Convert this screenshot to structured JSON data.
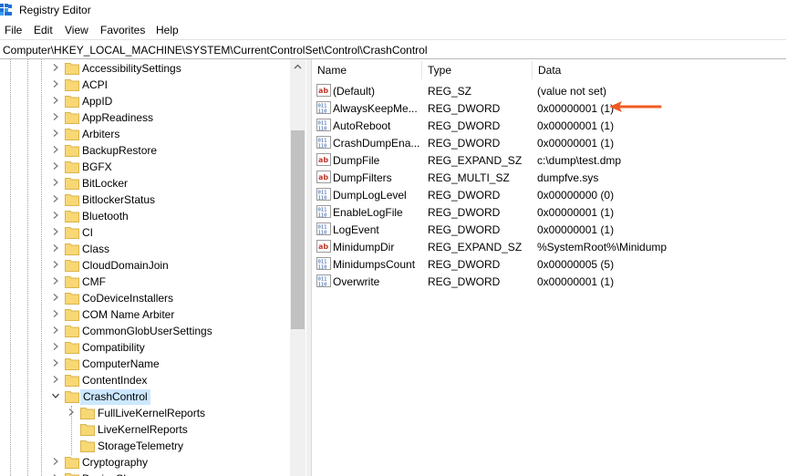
{
  "window": {
    "title": "Registry Editor",
    "icon": "registry-editor-icon"
  },
  "menu": [
    "File",
    "Edit",
    "View",
    "Favorites",
    "Help"
  ],
  "address": "Computer\\HKEY_LOCAL_MACHINE\\SYSTEM\\CurrentControlSet\\Control\\CrashControl",
  "tree": {
    "items": [
      {
        "label": "AccessibilitySettings"
      },
      {
        "label": "ACPI"
      },
      {
        "label": "AppID"
      },
      {
        "label": "AppReadiness"
      },
      {
        "label": "Arbiters"
      },
      {
        "label": "BackupRestore"
      },
      {
        "label": "BGFX"
      },
      {
        "label": "BitLocker"
      },
      {
        "label": "BitlockerStatus"
      },
      {
        "label": "Bluetooth"
      },
      {
        "label": "CI"
      },
      {
        "label": "Class"
      },
      {
        "label": "CloudDomainJoin"
      },
      {
        "label": "CMF"
      },
      {
        "label": "CoDeviceInstallers"
      },
      {
        "label": "COM Name Arbiter"
      },
      {
        "label": "CommonGlobUserSettings"
      },
      {
        "label": "Compatibility"
      },
      {
        "label": "ComputerName"
      },
      {
        "label": "ContentIndex"
      },
      {
        "label": "CrashControl"
      },
      {
        "label": "FullLiveKernelReports"
      },
      {
        "label": "LiveKernelReports"
      },
      {
        "label": "StorageTelemetry"
      },
      {
        "label": "Cryptography"
      },
      {
        "label": "DeviceClasses"
      }
    ],
    "selected": "CrashControl"
  },
  "list": {
    "columns": [
      "Name",
      "Type",
      "Data"
    ],
    "rows": [
      {
        "name": "(Default)",
        "type": "REG_SZ",
        "data": "(value not set)",
        "icon": "string-value-icon"
      },
      {
        "name": "AlwaysKeepMe...",
        "type": "REG_DWORD",
        "data": "0x00000001 (1)",
        "icon": "binary-value-icon"
      },
      {
        "name": "AutoReboot",
        "type": "REG_DWORD",
        "data": "0x00000001 (1)",
        "icon": "binary-value-icon"
      },
      {
        "name": "CrashDumpEna...",
        "type": "REG_DWORD",
        "data": "0x00000001 (1)",
        "icon": "binary-value-icon"
      },
      {
        "name": "DumpFile",
        "type": "REG_EXPAND_SZ",
        "data": "c:\\dump\\test.dmp",
        "icon": "string-value-icon"
      },
      {
        "name": "DumpFilters",
        "type": "REG_MULTI_SZ",
        "data": "dumpfve.sys",
        "icon": "string-value-icon"
      },
      {
        "name": "DumpLogLevel",
        "type": "REG_DWORD",
        "data": "0x00000000 (0)",
        "icon": "binary-value-icon"
      },
      {
        "name": "EnableLogFile",
        "type": "REG_DWORD",
        "data": "0x00000001 (1)",
        "icon": "binary-value-icon"
      },
      {
        "name": "LogEvent",
        "type": "REG_DWORD",
        "data": "0x00000001 (1)",
        "icon": "binary-value-icon"
      },
      {
        "name": "MinidumpDir",
        "type": "REG_EXPAND_SZ",
        "data": "%SystemRoot%\\Minidump",
        "icon": "string-value-icon"
      },
      {
        "name": "MinidumpsCount",
        "type": "REG_DWORD",
        "data": "0x00000005 (5)",
        "icon": "binary-value-icon"
      },
      {
        "name": "Overwrite",
        "type": "REG_DWORD",
        "data": "0x00000001 (1)",
        "icon": "binary-value-icon"
      }
    ]
  },
  "colors": {
    "folder": "#f8d775",
    "selection": "#cce8ff",
    "annotation_arrow": "#f05a22",
    "string_icon": "#c0392b",
    "binary_icon": "#1f4e9c"
  }
}
